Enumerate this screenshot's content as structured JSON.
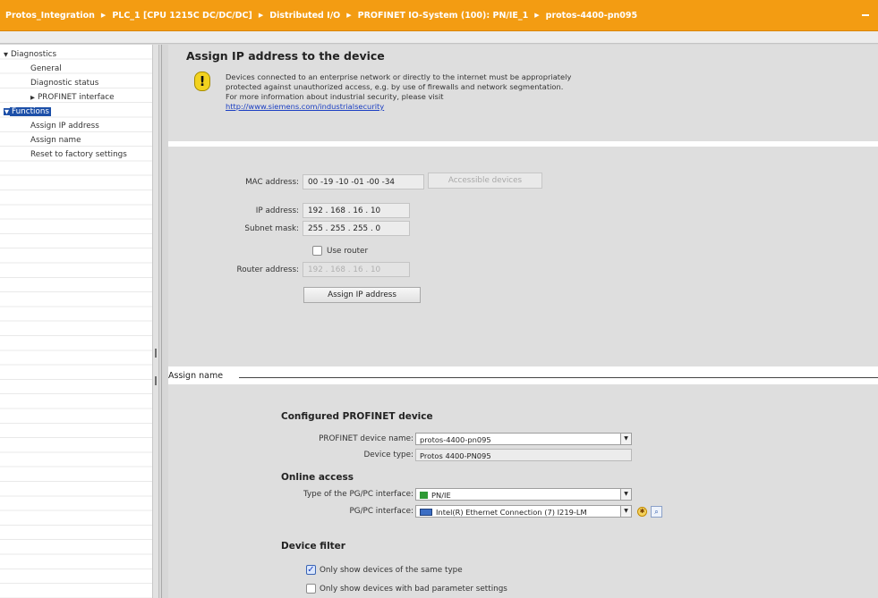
{
  "breadcrumb": [
    "Protos_Integration",
    "PLC_1 [CPU 1215C DC/DC/DC]",
    "Distributed I/O",
    "PROFINET IO-System (100): PN/IE_1",
    "protos-4400-pn095"
  ],
  "nav": {
    "diagnostics": "Diagnostics",
    "general": "General",
    "diagnostic_status": "Diagnostic status",
    "profinet_interface": "PROFINET interface",
    "functions": "Functions",
    "assign_ip_address": "Assign IP address",
    "assign_name": "Assign name",
    "reset_factory": "Reset to factory settings"
  },
  "assign_ip": {
    "title": "Assign IP address to the device",
    "warning_lines": [
      "Devices connected to an enterprise network or directly to the internet must be appropriately",
      "protected against unauthorized access, e.g. by use of firewalls and network segmentation.",
      "For more information about industrial security, please visit"
    ],
    "warning_link": "http://www.siemens.com/industrialsecurity",
    "mac_label": "MAC address:",
    "mac_value": "00 -19 -10 -01 -00 -34",
    "accessible_devices_btn": "Accessible devices",
    "ip_label": "IP address:",
    "ip_value": "192 . 168 . 16  . 10",
    "subnet_label": "Subnet mask:",
    "subnet_value": "255 . 255 . 255 . 0",
    "use_router_label": "Use router",
    "use_router_checked": false,
    "router_label": "Router address:",
    "router_value": "192 . 168 . 16  . 10",
    "assign_btn": "Assign IP address"
  },
  "assign_name": {
    "header": "Assign name",
    "configured_title": "Configured PROFINET device",
    "device_name_label": "PROFINET device name:",
    "device_name_value": "protos-4400-pn095",
    "device_type_label": "Device type:",
    "device_type_value": "Protos 4400-PN095",
    "online_title": "Online access",
    "pgpc_type_label": "Type of the PG/PC interface:",
    "pgpc_type_value": "PN/IE",
    "pgpc_iface_label": "PG/PC interface:",
    "pgpc_iface_value": "Intel(R) Ethernet Connection (7) I219-LM",
    "filter_title": "Device filter",
    "filter_same_type": "Only show devices of the same type",
    "filter_same_type_checked": true,
    "filter_bad_params": "Only show devices with bad parameter settings",
    "filter_bad_params_checked": false
  },
  "colors": {
    "title_bar": "#f39c12",
    "selection": "#1c4fa8",
    "link": "#1a3ec2"
  }
}
